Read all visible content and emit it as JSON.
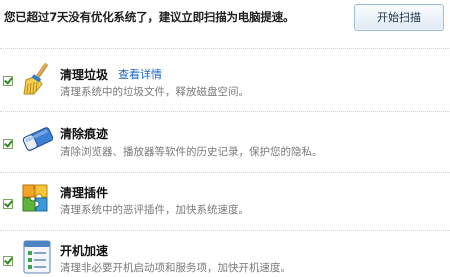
{
  "header": {
    "message": "您已超过7天没有优化系统了，建议立即扫描为电脑提速。",
    "scan_button": "开始扫描"
  },
  "items": [
    {
      "title": "清理垃圾",
      "link": "查看详情",
      "desc": "清理系统中的垃圾文件，释放磁盘空间。",
      "icon": "broom-icon",
      "checked": true
    },
    {
      "title": "清除痕迹",
      "desc": "清除浏览器、播放器等软件的历史记录，保护您的隐私。",
      "icon": "eraser-icon",
      "checked": true
    },
    {
      "title": "清理插件",
      "desc": "清理系统中的恶评插件，加快系统速度。",
      "icon": "puzzle-icon",
      "checked": true
    },
    {
      "title": "开机加速",
      "desc": "清理非必要开机启动项和服务项，加快开机速度。",
      "icon": "startup-list-icon",
      "checked": true
    }
  ],
  "colors": {
    "link": "#1a64c8",
    "checkmark": "#2c8a1d",
    "description": "#7a7a7a"
  }
}
